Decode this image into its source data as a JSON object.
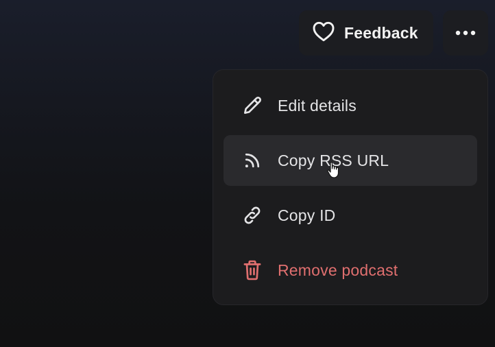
{
  "header": {
    "feedback_label": "Feedback",
    "feedback_icon": "heart-icon",
    "more_icon": "more-horizontal-icon"
  },
  "menu": {
    "items": [
      {
        "label": "Edit details",
        "icon": "pencil-icon",
        "state": "normal"
      },
      {
        "label": "Copy RSS URL",
        "icon": "rss-icon",
        "state": "hovered"
      },
      {
        "label": "Copy ID",
        "icon": "link-icon",
        "state": "normal"
      },
      {
        "label": "Remove podcast",
        "icon": "trash-icon",
        "state": "danger"
      }
    ]
  },
  "colors": {
    "danger": "#e06f6f",
    "menu_bg": "#1c1c1e",
    "hover_bg": "#2a2a2d"
  }
}
